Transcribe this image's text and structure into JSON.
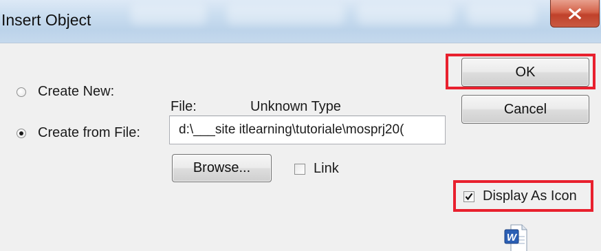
{
  "window": {
    "title": "Insert Object",
    "close_glyph": "X"
  },
  "options": {
    "create_new_label": "Create New:",
    "create_from_file_label": "Create from File:",
    "selected": "create_from_file"
  },
  "file": {
    "label": "File:",
    "type_text": "Unknown Type",
    "path_value": "d:\\___site itlearning\\tutoriale\\mosprj20("
  },
  "buttons": {
    "browse_label": "Browse...",
    "ok_label": "OK",
    "cancel_label": "Cancel"
  },
  "checkboxes": {
    "link_label": "Link",
    "link_checked": false,
    "display_as_icon_label": "Display As Icon",
    "display_as_icon_checked": true
  },
  "icons": {
    "file_icon": "word-document-icon"
  },
  "colors": {
    "highlight": "#e8202e",
    "titlebar": "#c8dcef",
    "close_button": "#c9503a"
  }
}
